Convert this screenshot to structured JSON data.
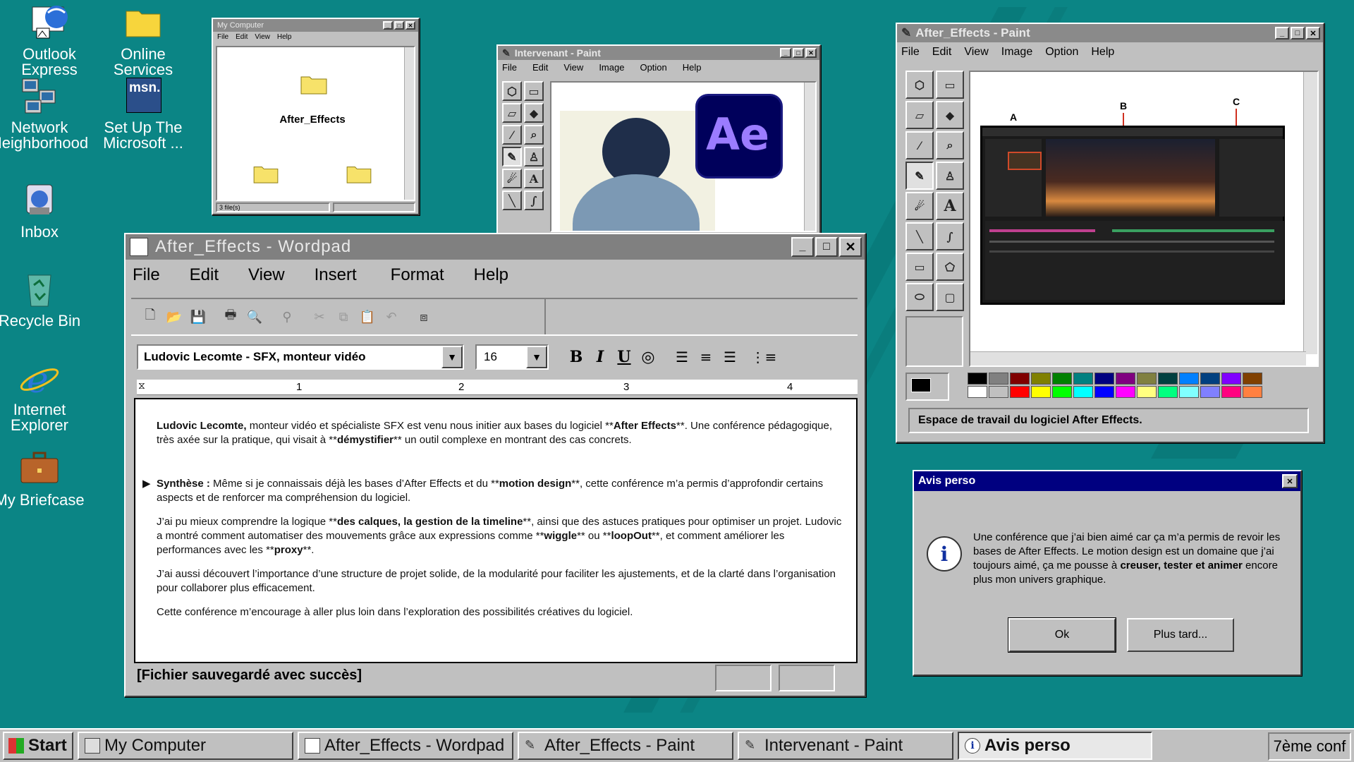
{
  "desktop": {
    "icons": [
      {
        "label": "Outlook Express"
      },
      {
        "label": "Online Services"
      },
      {
        "label": "Network Neighborhood"
      },
      {
        "label": "Set Up The Microsoft ..."
      },
      {
        "label": "Inbox"
      },
      {
        "label": "Recycle Bin"
      },
      {
        "label": "Internet Explorer"
      },
      {
        "label": "My Briefcase"
      }
    ],
    "msn_logo": "msn."
  },
  "my_computer": {
    "title": "My Computer",
    "menu": [
      "File",
      "Edit",
      "View",
      "Help"
    ],
    "folder_label": "After_Effects",
    "status": "3 file(s)"
  },
  "paint_intervenant": {
    "title": "Intervenant - Paint",
    "menu": [
      "File",
      "Edit",
      "View",
      "Image",
      "Option",
      "Help"
    ],
    "ae_logo": "Ae"
  },
  "paint_ae": {
    "title": "After_Effects - Paint",
    "menu": [
      "File",
      "Edit",
      "View",
      "Image",
      "Option",
      "Help"
    ],
    "annotations": [
      "A",
      "B",
      "C"
    ],
    "status": "Espace de travail du logiciel After Effects.",
    "palette_top": [
      "#000000",
      "#808080",
      "#800000",
      "#808000",
      "#008000",
      "#008080",
      "#000080",
      "#800080",
      "#808040",
      "#004040",
      "#0080ff",
      "#004080",
      "#8000ff",
      "#804000"
    ],
    "palette_bottom": [
      "#ffffff",
      "#c0c0c0",
      "#ff0000",
      "#ffff00",
      "#00ff00",
      "#00ffff",
      "#0000ff",
      "#ff00ff",
      "#ffff80",
      "#00ff80",
      "#80ffff",
      "#8080ff",
      "#ff0080",
      "#ff8040"
    ]
  },
  "wordpad": {
    "title": "After_Effects - Wordpad",
    "menu": [
      "File",
      "Edit",
      "View",
      "Insert",
      "Format",
      "Help"
    ],
    "font_name": "Ludovic Lecomte - SFX, monteur vidéo",
    "font_size": "16",
    "bold": "B",
    "italic": "I",
    "underline": "U",
    "ruler": [
      "1",
      "2",
      "3",
      "4"
    ],
    "doc": {
      "p1": {
        "b1": "Ludovic Lecomte,",
        "t1": " monteur vidéo et spécialiste SFX  est venu nous initier aux bases du logiciel **",
        "b2": "After Effects",
        "t2": "**. Une conférence pédagogique, très axée sur la pratique, qui visait à **",
        "b3": "démystifier",
        "t3": "** un outil complexe en montrant des cas concrets."
      },
      "p2": {
        "bullet": "▶",
        "b1": "Synthèse :",
        "t1": " Même si je connaissais déjà les bases d’After Effects et du **",
        "b2": "motion design",
        "t2": "**, cette conférence m’a permis d’approfondir certains aspects et de renforcer ma compréhension du logiciel."
      },
      "p3": {
        "t1": "J’ai pu mieux comprendre la logique **",
        "b1": "des calques, la gestion de la timeline",
        "t2": "**, ainsi que des astuces pratiques pour optimiser un projet. Ludovic a montré comment automatiser des mouvements grâce aux expressions comme **",
        "b2": "wiggle",
        "t3": "** ou **",
        "b3": "loopOut",
        "t4": "**, et comment améliorer les performances avec les **",
        "b4": "proxy",
        "t5": "**."
      },
      "p4": "J’ai aussi découvert l’importance d’une structure de projet solide, de la modularité pour faciliter les ajustements, et de la clarté dans l’organisation pour collaborer plus efficacement.",
      "p5": "Cette conférence m’encourage à aller plus loin dans l’exploration des possibilités créatives du logiciel."
    },
    "status": "[Fichier sauvegardé avec succès]"
  },
  "dialog": {
    "title": "Avis perso",
    "message_t1": "Une conférence que j’ai bien aimé car ça m’a permis de revoir les bases de After Effects. Le motion design est un domaine que j’ai toujours aimé, ça me pousse à ",
    "message_b1": "creuser, tester et animer",
    "message_t2": " encore plus mon univers graphique.",
    "ok": "Ok",
    "later": "Plus tard..."
  },
  "taskbar": {
    "start": "Start",
    "tasks": [
      "My Computer",
      "After_Effects - Wordpad",
      "After_Effects - Paint",
      "Intervenant - Paint",
      "Avis perso"
    ],
    "clock": "7ème conf"
  }
}
